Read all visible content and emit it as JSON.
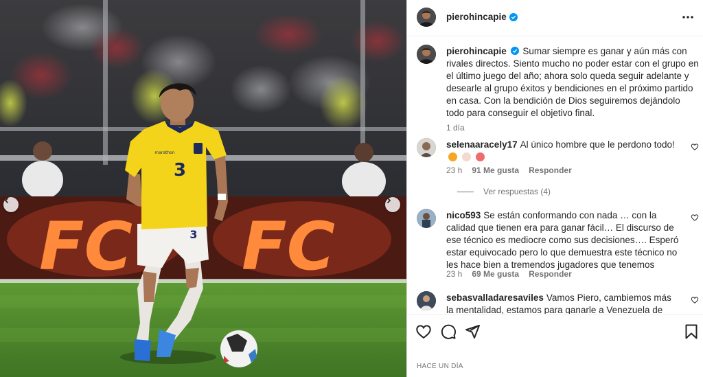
{
  "post": {
    "username": "pierohincapie",
    "verified": true,
    "caption": "Sumar siempre es ganar y aún más con rivales directos. Siento mucho no poder estar con el grupo en el último juego del año; ahora solo queda seguir adelante y desearle al grupo éxitos y bendiciones en el próximo partido en casa. Con la bendición de Dios seguiremos dejándolo todo para conseguir el objetivo final.",
    "caption_time": "1 día",
    "time_ago": "HACE UN DÍA"
  },
  "photo": {
    "banner_text": "FC",
    "jersey_number": "3",
    "shirt_brand": "marathon"
  },
  "comments": [
    {
      "username": "selenaaracely17",
      "text": "Al único hombre que le perdono todo!",
      "time": "23 h",
      "likes": "91 Me gusta",
      "reply_label": "Responder",
      "view_replies": "Ver respuestas (4)"
    },
    {
      "username": "nico593",
      "text": "Se están conformando con nada … con la calidad que tienen era para ganar fácil… El discurso de ese técnico es mediocre como sus decisiones…. Esperó estar equivocado pero lo que demuestra este técnico no les hace bien a tremendos jugadores que tenemos",
      "time": "23 h",
      "likes": "69 Me gusta",
      "reply_label": "Responder"
    },
    {
      "username": "sebasvalladaresaviles",
      "text": "Vamos Piero, cambiemos más la mentalidad, estamos para ganarle a Venezuela de visitante."
    }
  ],
  "icons": {
    "more": "more-options-icon",
    "like": "heart-icon",
    "comment": "comment-icon",
    "share": "share-icon",
    "save": "bookmark-icon",
    "prev": "chevron-left-icon",
    "next": "chevron-right-icon",
    "verified": "verified-badge-icon"
  },
  "colors": {
    "verified": "#0095f6",
    "jersey": "#f4d41a",
    "pitch": "#4f8a2e"
  }
}
